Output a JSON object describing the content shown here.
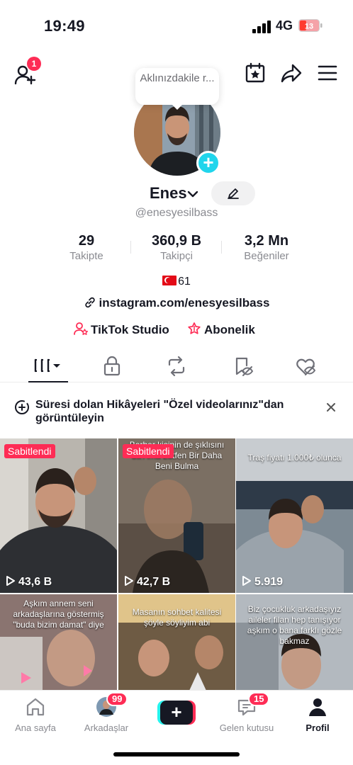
{
  "status_bar": {
    "time": "19:49",
    "network": "4G",
    "battery": "13"
  },
  "profile": {
    "bubble_text": "Aklınızdakile r...",
    "name": "Enes",
    "handle": "@enesyesilbass",
    "stats": [
      {
        "value": "29",
        "label": "Takipte"
      },
      {
        "value": "360,9 B",
        "label": "Takipçi"
      },
      {
        "value": "3,2 Mn",
        "label": "Beğeniler"
      }
    ],
    "flag_text": "61",
    "link": "instagram.com/enesyesilbass",
    "tools": {
      "studio": "TikTok Studio",
      "subscription": "Abonelik"
    },
    "add_friend_badge": "1"
  },
  "banner": {
    "text": "Süresi dolan Hikâyeleri \"Özel videolarınız\"dan görüntüleyin"
  },
  "grid": {
    "pinned_label": "Sabitlendi",
    "items": [
      {
        "views": "43,6 B",
        "caption": ""
      },
      {
        "views": "42,7 B",
        "caption": "Berber kişinin de şıklısını da Ama Lütfen Bir Daha Beni Bulma"
      },
      {
        "views": "5.919",
        "caption": "Traş fiyatı 1.000₺ olunca"
      },
      {
        "views": "",
        "caption": "Aşkım annem seni arkadaşlarına göstermiş \"buda bizim damat\" diye"
      },
      {
        "views": "",
        "caption": "Masanın sohbet kalitesi şöyle söyliyim abi"
      },
      {
        "views": "",
        "caption": "Biz çocukluk arkadaşıyız aileler filan hep tanışıyor aşkım o bana farklı gözle bakmaz"
      }
    ]
  },
  "bottom_nav": {
    "home": "Ana sayfa",
    "friends": "Arkadaşlar",
    "friends_badge": "99",
    "inbox": "Gelen kutusu",
    "inbox_badge": "15",
    "profile": "Profil"
  }
}
